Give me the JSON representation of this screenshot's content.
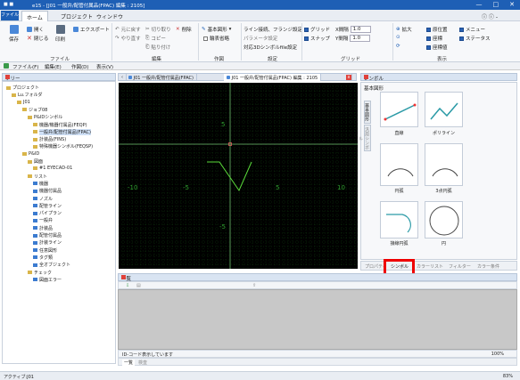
{
  "app": {
    "title_icons": "■ ■",
    "title": "e15 - [J01 一般弁/配管付属品(FPAC) 編集 : 2105]",
    "wb_min": "—",
    "wb_max": "□",
    "wb_close": "✕"
  },
  "menu": {
    "app": "ファイル",
    "home": "ホーム",
    "project": "プロジェクト",
    "window": "ウィンドウ",
    "help_icons": "ⓘ ⓘ -"
  },
  "ribbon": {
    "save": "保存",
    "open": "開く",
    "close": "閉じる",
    "print": "印刷",
    "export": "エクスポート",
    "undo": "元に戻す",
    "redo": "やり直す",
    "cut": "切り取り",
    "delete": "削除",
    "copy": "コピー",
    "paste": "貼り付け",
    "basic_shape": "基本図形",
    "line_setting": "ライン接続、フランジ設定",
    "param_setting": "パラメータ設定",
    "hide_hatch": "輪表省略",
    "support3d": "対応3Dシンボルfile設定",
    "grid": "グリッド",
    "snap": "スナップ",
    "x_spacing_label": "X間隔",
    "x_spacing": "1.0",
    "y_spacing_label": "Y間隔",
    "y_spacing": "1.0",
    "zoom_in": "拡大",
    "zoom_fit": "",
    "origin": "原位置",
    "coord": "座標",
    "axis": "座標値",
    "menu": "メニュー",
    "status": "ステータス",
    "grp_file": "ファイル",
    "grp_edit": "編集",
    "grp_draw": "作図",
    "grp_setting": "設定",
    "grp_grid": "グリッド",
    "grp_view": "表示"
  },
  "filebar": {
    "file": "ファイル(F)",
    "edit": "編集(E)",
    "draw": "作図(D)",
    "view": "表示(V)"
  },
  "tree": {
    "header": "ツリー",
    "nodes": [
      "プロジェクト",
      "Lu.フォルダ",
      "J01",
      "ジョブ08",
      "P&IDシンボル",
      "機器/機器付属品(FEQP)",
      "一般弁/配管付属品(FPAC)",
      "計装品(FINS)",
      "特殊機器シンボル(FEQSP)",
      "P&ID",
      "図面",
      "#1 EYECAD-01",
      "リスト",
      "機器",
      "機器付属品",
      "ノズル",
      "配管ライン",
      "パイプラン",
      "一般弁",
      "計装品",
      "配管付属品",
      "計装ライン",
      "任意図形",
      "タグ類",
      "全オブジェクト",
      "チェック",
      "図面エラー"
    ]
  },
  "tabs": {
    "t1": "J01 一般弁/配管付属品(FPAC)",
    "t2": "J01 一般弁/配管付属品(FPAC) 編集 : 2105",
    "x": "x"
  },
  "canvas": {
    "m10": "-10",
    "m5": "-5",
    "p5": "5",
    "p10": "10",
    "y5": "5",
    "ym5": "-5"
  },
  "symbol": {
    "header": "シンボル",
    "category": "基本図形",
    "vt1": "基本図形",
    "vt2": "汎用シンボル",
    "items": [
      "直線",
      "ポリライン",
      "円弧",
      "3点円弧",
      "接線円弧",
      "円"
    ]
  },
  "bottom_tabs": [
    "プロパティ",
    "シンボル",
    "カラーリスト",
    "フィルター",
    "カラー条件"
  ],
  "list": {
    "header": "一覧",
    "status_left": "ID-コード表示しています",
    "zoom": "100%",
    "tab1": "一覧",
    "tab2": "検査"
  },
  "statusbar": {
    "left": "アクティブ:J01",
    "right": "83%"
  },
  "colors": {
    "accent": "#1e5fb5",
    "highlight": "#e00000",
    "grid": "#1c6f1c",
    "shape": "#5adb3a",
    "origin": "#e06060"
  }
}
